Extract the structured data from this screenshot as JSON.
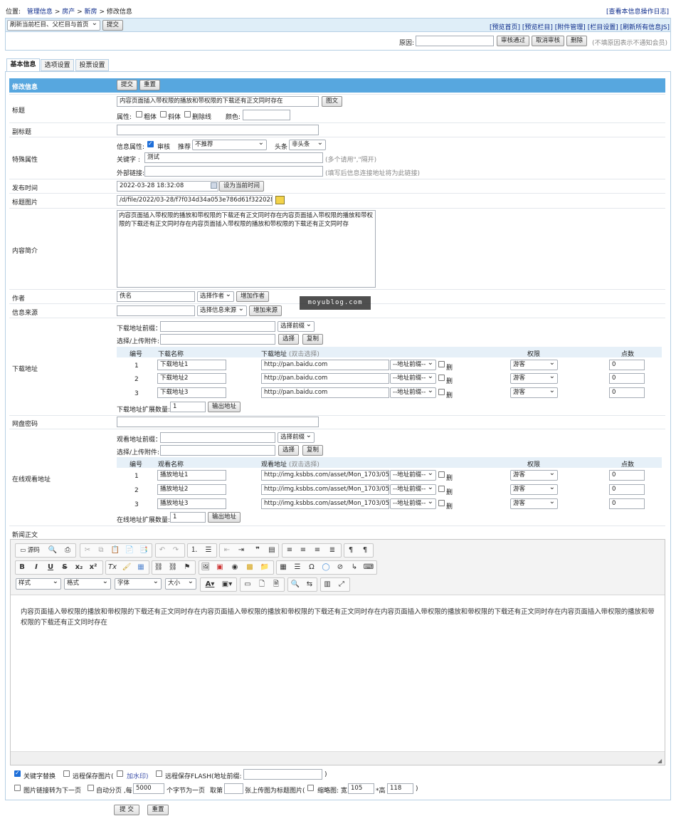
{
  "breadcrumb": {
    "prefix": "位置:",
    "items": [
      "管理信息",
      ">",
      "房产",
      ">",
      "新房",
      ">",
      "修改信息"
    ],
    "log_link": "[查看本信息操作日志]"
  },
  "refresh": {
    "select": "刷新当前栏目、父栏目与首页",
    "submit": "提交",
    "links": [
      "[预览首页]",
      "[预览栏目]",
      "[附件管理]",
      "[栏目设置]",
      "[刷新所有信息JS]"
    ]
  },
  "audit": {
    "reason_label": "原因:",
    "approve": "审核通过",
    "cancel": "取消审核",
    "delete": "删除",
    "note": "(不填原因表示不通知会员)"
  },
  "tabs": [
    "基本信息",
    "选项设置",
    "投票设置"
  ],
  "form_header": {
    "title": "修改信息",
    "submit": "提交",
    "reset": "重置"
  },
  "title_row": {
    "label": "标题",
    "value": "内容页面插入带权限的播放和带权限的下载还有正文同时存在",
    "image_btn": "图文",
    "attr_label": "属性:",
    "bold": "粗体",
    "italic": "斜体",
    "strike": "删除线",
    "color_label": "颜色:"
  },
  "subtitle_row": {
    "label": "副标题"
  },
  "special": {
    "label": "特殊属性",
    "info_attr": "信息属性:",
    "audit": "审核",
    "recommend_label": "推荐",
    "recommend_value": "不推荐",
    "headline_label": "头条",
    "headline_value": "非头条",
    "keyword_label": "关键字 :",
    "keyword_value": "测试",
    "keyword_note": "(多个请用\",\"隔开)",
    "link_label": "外部链接:",
    "link_note": "(填写后信息连接地址将为此链接)"
  },
  "publish": {
    "label": "发布时间",
    "value": "2022-03-28 18:32:08",
    "btn": "设为当前时间"
  },
  "title_pic": {
    "label": "标题图片",
    "value": "/d/file/2022/03-28/f7f034d34a053e786d61f322028144"
  },
  "intro": {
    "label": "内容简介",
    "value": "内容页面插入带权限的播放和带权限的下载还有正文同时存在内容页面插入带权限的播放和带权限的下载还有正文同时存在内容页面插入带权限的播放和带权限的下载还有正文同时存"
  },
  "author": {
    "label": "作者",
    "value": "佚名",
    "select": "选择作者",
    "add": "增加作者"
  },
  "source": {
    "label": "信息来源",
    "select": "选择信息来源",
    "add": "增加来源"
  },
  "watermark": "moyublog.com",
  "download": {
    "label": "下载地址",
    "prefix_label": "下载地址前缀：",
    "prefix_select": "选择前缀",
    "upload_label": "选择/上传附件:",
    "choose": "选择",
    "copy": "复制",
    "cols": [
      "编号",
      "下载名称",
      "下载地址",
      "(双击选择)",
      "权限",
      "点数"
    ],
    "rows": [
      {
        "no": "1",
        "name": "下载地址1",
        "url": "http://pan.baidu.com",
        "prefix": "--地址前缀--",
        "del": "删",
        "perm": "游客",
        "points": "0"
      },
      {
        "no": "2",
        "name": "下载地址2",
        "url": "http://pan.baidu.com",
        "prefix": "--地址前缀--",
        "del": "删",
        "perm": "游客",
        "points": "0"
      },
      {
        "no": "3",
        "name": "下载地址3",
        "url": "http://pan.baidu.com",
        "prefix": "--地址前缀--",
        "del": "删",
        "perm": "游客",
        "points": "0"
      }
    ],
    "ext_label": "下载地址扩展数量:",
    "ext_value": "1",
    "output": "输出地址"
  },
  "pan_pwd": {
    "label": "网盘密码"
  },
  "online": {
    "label": "在线观看地址",
    "prefix_label": "观看地址前缀：",
    "prefix_select": "选择前缀",
    "upload_label": "选择/上传附件:",
    "choose": "选择",
    "copy": "复制",
    "cols": [
      "编号",
      "观看名称",
      "观看地址",
      "(双击选择)",
      "权限",
      "点数"
    ],
    "rows": [
      {
        "no": "1",
        "name": "播放地址1",
        "url": "http://img.ksbbs.com/asset/Mon_1703/05cac",
        "prefix": "--地址前缀--",
        "del": "删",
        "perm": "游客",
        "points": "0"
      },
      {
        "no": "2",
        "name": "播放地址2",
        "url": "http://img.ksbbs.com/asset/Mon_1703/05cac",
        "prefix": "--地址前缀--",
        "del": "删",
        "perm": "游客",
        "points": "0"
      },
      {
        "no": "3",
        "name": "播放地址3",
        "url": "http://img.ksbbs.com/asset/Mon_1703/05cac",
        "prefix": "--地址前缀--",
        "del": "删",
        "perm": "游客",
        "points": "0"
      }
    ],
    "ext_label": "在线地址扩展数量:",
    "ext_value": "1",
    "output": "输出地址"
  },
  "news": {
    "label": "新闻正文",
    "source_btn": "源码",
    "styles": "样式",
    "format": "格式",
    "font": "字体",
    "size": "大小",
    "body": "内容页面插入带权限的播放和带权限的下载还有正文同时存在内容页面插入带权限的播放和带权限的下载还有正文同时存在内容页面插入带权限的播放和带权限的下载还有正文同时存在内容页面插入带权限的播放和带权限的下载还有正文同时存在"
  },
  "options": {
    "kw_replace": "关键字替换",
    "remote_pic": "远程保存图片(",
    "watermark": "加水印)",
    "remote_flash": "远程保存FLASH(地址前缀:",
    "close_paren": ")",
    "pic_next": "图片链接转为下一页",
    "auto_page": "自动分页 ,每",
    "page_chars": "5000",
    "page_unit": "个字节为一页",
    "take_label": "取第",
    "take_suffix": "张上传图为标题图片(",
    "thumb": "缩略图: 宽",
    "thumb_w": "105",
    "thumb_h_label": "*高",
    "thumb_h": "118",
    "end_paren": ")"
  },
  "bottom": {
    "submit": "提 交",
    "reset": "重置"
  }
}
